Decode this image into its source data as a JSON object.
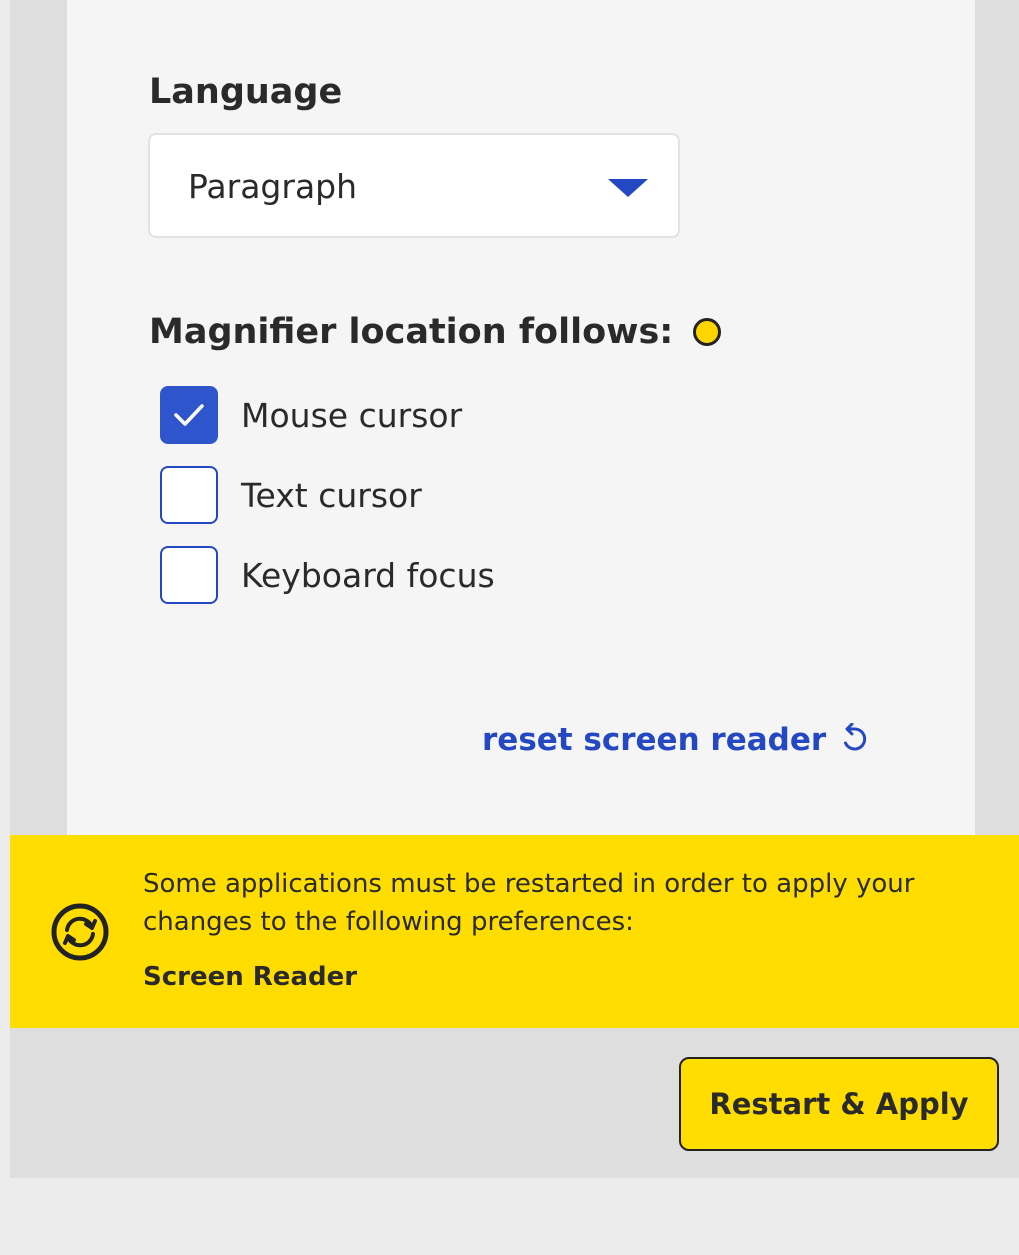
{
  "language": {
    "title": "Language",
    "selected": "Paragraph"
  },
  "magnifier": {
    "title": "Magnifier location follows:",
    "options": [
      {
        "label": "Mouse cursor",
        "checked": true
      },
      {
        "label": "Text cursor",
        "checked": false
      },
      {
        "label": "Keyboard focus",
        "checked": false
      }
    ]
  },
  "reset": {
    "label": "reset screen reader",
    "icon": "undo-icon"
  },
  "banner": {
    "icon": "sync-icon",
    "message": "Some applications must be restarted in order to apply your changes to the following preferences:",
    "preference": "Screen Reader"
  },
  "actions": {
    "restart_apply": "Restart & Apply"
  },
  "colors": {
    "accent_blue": "#2447c2",
    "banner_yellow": "#ffdd00",
    "panel_bg": "#f5f5f5",
    "outer_bg": "#dedede"
  }
}
